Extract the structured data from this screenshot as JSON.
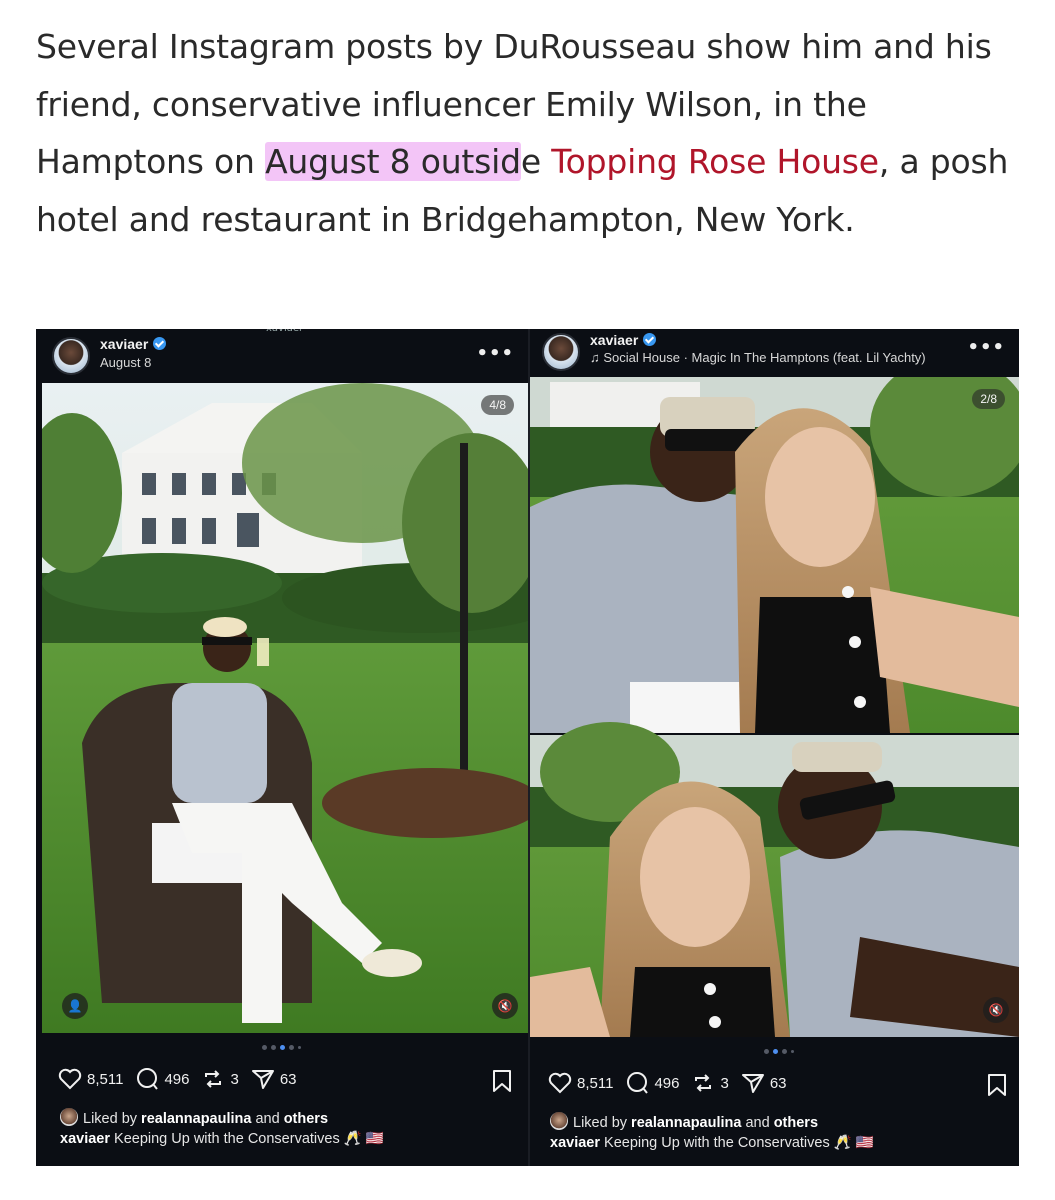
{
  "article": {
    "before_highlight": "Several Instagram posts by DuRousseau show him and his friend, conservative influencer Emily Wilson, in the Hamptons on ",
    "highlight": "August 8 outsid",
    "after_highlight": "e ",
    "link": "Topping Rose House",
    "after_link": ", a posh hotel and restaurant in Bridgehampton, New York."
  },
  "left_post": {
    "peek_username": "xaviaer",
    "username": "xaviaer",
    "subline": "August 8",
    "counter": "4/8",
    "likes": "8,511",
    "comments": "496",
    "reposts": "3",
    "shares": "63",
    "liked_prefix": "Liked by ",
    "liked_user": "realannapaulina",
    "liked_mid": " and ",
    "liked_others": "others",
    "caption_user": "xaviaer",
    "caption_text": " Keeping Up with the Conservatives 🥂 🇺🇸"
  },
  "right_post": {
    "username": "xaviaer",
    "music_icon": "♫",
    "subline": "Social House · Magic In The Hamptons (feat. Lil Yachty)",
    "counter": "2/8",
    "likes": "8,511",
    "comments": "496",
    "reposts": "3",
    "shares": "63",
    "liked_prefix": "Liked by ",
    "liked_user": "realannapaulina",
    "liked_mid": " and ",
    "liked_others": "others",
    "caption_user": "xaviaer",
    "caption_text": " Keeping Up with the Conservatives 🥂 🇺🇸"
  },
  "icons": {
    "more": "•••",
    "mute": "🔇",
    "person": "👤"
  },
  "colors": {
    "highlight": "#f3c5f7",
    "link": "#b0152a",
    "verified": "#3897f0",
    "background": "#0b0e14"
  }
}
